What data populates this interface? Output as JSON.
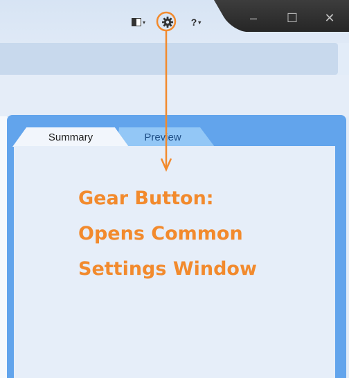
{
  "toolbar": {
    "layout_icon": "panel-layout-icon",
    "settings_icon": "gear-icon",
    "help_label": "?",
    "dropdown_caret": "▾"
  },
  "window_controls": {
    "minimize": "–",
    "maximize": "☐",
    "close": "✕"
  },
  "tabs": [
    {
      "label": "Summary",
      "active": true
    },
    {
      "label": "Preview",
      "active": false
    }
  ],
  "annotation": {
    "line1": "Gear Button:",
    "line2": "Opens Common",
    "line3": "Settings Window",
    "color": "#f28a2d"
  },
  "colors": {
    "panel_border": "#62a4ec",
    "caption_bar": "#2e2e2e",
    "content_bg": "#e6eef9"
  }
}
